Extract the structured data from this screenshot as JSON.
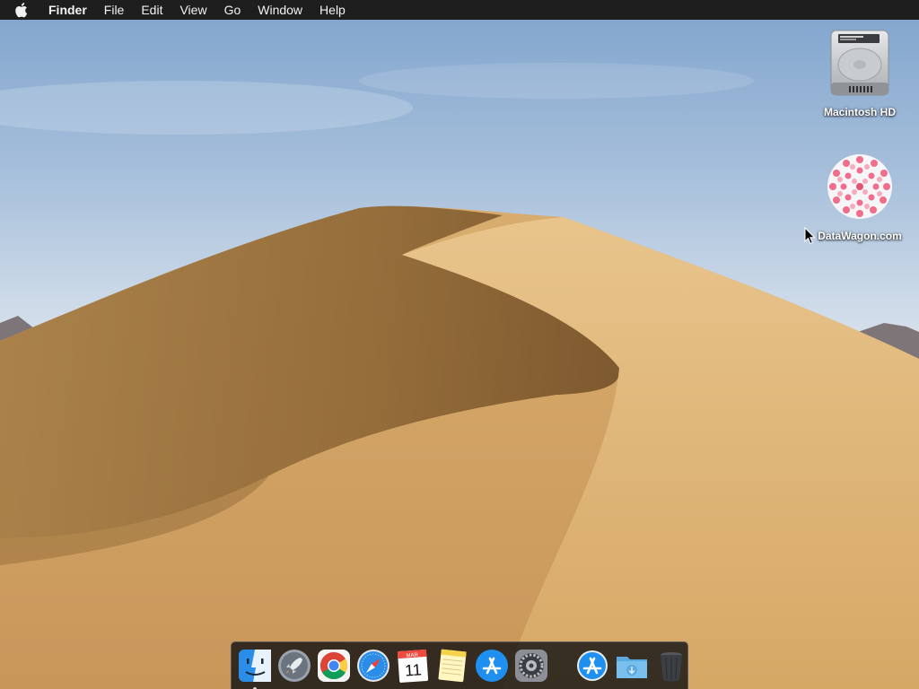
{
  "menubar": {
    "app_name": "Finder",
    "items": [
      "File",
      "Edit",
      "View",
      "Go",
      "Window",
      "Help"
    ]
  },
  "desktop": {
    "icons": [
      {
        "label": "Macintosh HD",
        "icon": "hard-drive-icon"
      },
      {
        "label": "DataWagon.com",
        "icon": "floral-image-icon"
      }
    ]
  },
  "dock": {
    "apps": [
      {
        "icon": "finder-icon",
        "running": true
      },
      {
        "icon": "launchpad-icon",
        "running": false
      },
      {
        "icon": "chrome-icon",
        "running": false
      },
      {
        "icon": "safari-icon",
        "running": false
      },
      {
        "icon": "calendar-icon",
        "running": false,
        "month": "MAR",
        "day": "11"
      },
      {
        "icon": "notes-icon",
        "running": false
      },
      {
        "icon": "app-store-icon",
        "running": false
      },
      {
        "icon": "system-preferences-icon",
        "running": false
      }
    ],
    "right": [
      {
        "icon": "app-store-download-icon"
      },
      {
        "icon": "downloads-folder-icon"
      },
      {
        "icon": "trash-icon"
      }
    ]
  },
  "colors": {
    "menubar_bg": "#1e1e1e",
    "sky_top": "#7fa3cc",
    "sand": "#d6a866",
    "dock_bg": "#141414"
  }
}
